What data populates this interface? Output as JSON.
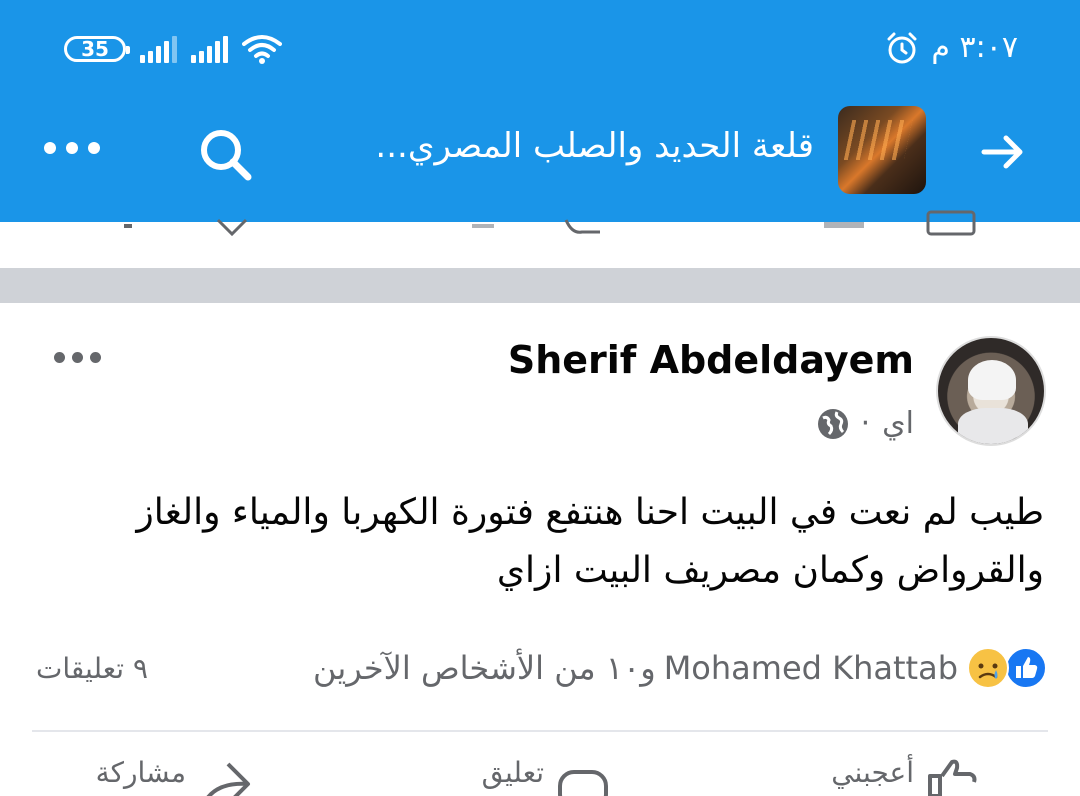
{
  "status_bar": {
    "battery": "35",
    "time": "٣:٠٧ م",
    "icons": [
      "signal-icon",
      "signal-icon",
      "wifi-icon",
      "alarm-icon"
    ]
  },
  "app_bar": {
    "title": "قلعة الحديد والصلب المصري...",
    "back_icon": "arrow-right-icon",
    "search_icon": "search-icon",
    "more_icon": "more-horizontal-icon",
    "accent": "#1a95e8"
  },
  "post": {
    "author": "Sherif Abdeldayem",
    "time": "اي",
    "separator": "·",
    "privacy_icon": "globe-icon",
    "text_line1": "طيب لم نعت في البيت احنا هنتفع فتورة الكهربا والمياء والغاز",
    "text_line2": "والقرواض وكمان مصريف البيت ازاي",
    "reactions": {
      "icons": [
        "like-icon",
        "sad-icon"
      ],
      "names": "Mohamed Khattab",
      "others": "و١٠ من الأشخاص الآخرين"
    },
    "comments_count": "٩ تعليقات",
    "actions": {
      "like": "أعجبني",
      "comment": "تعليق",
      "share": "مشاركة"
    }
  }
}
